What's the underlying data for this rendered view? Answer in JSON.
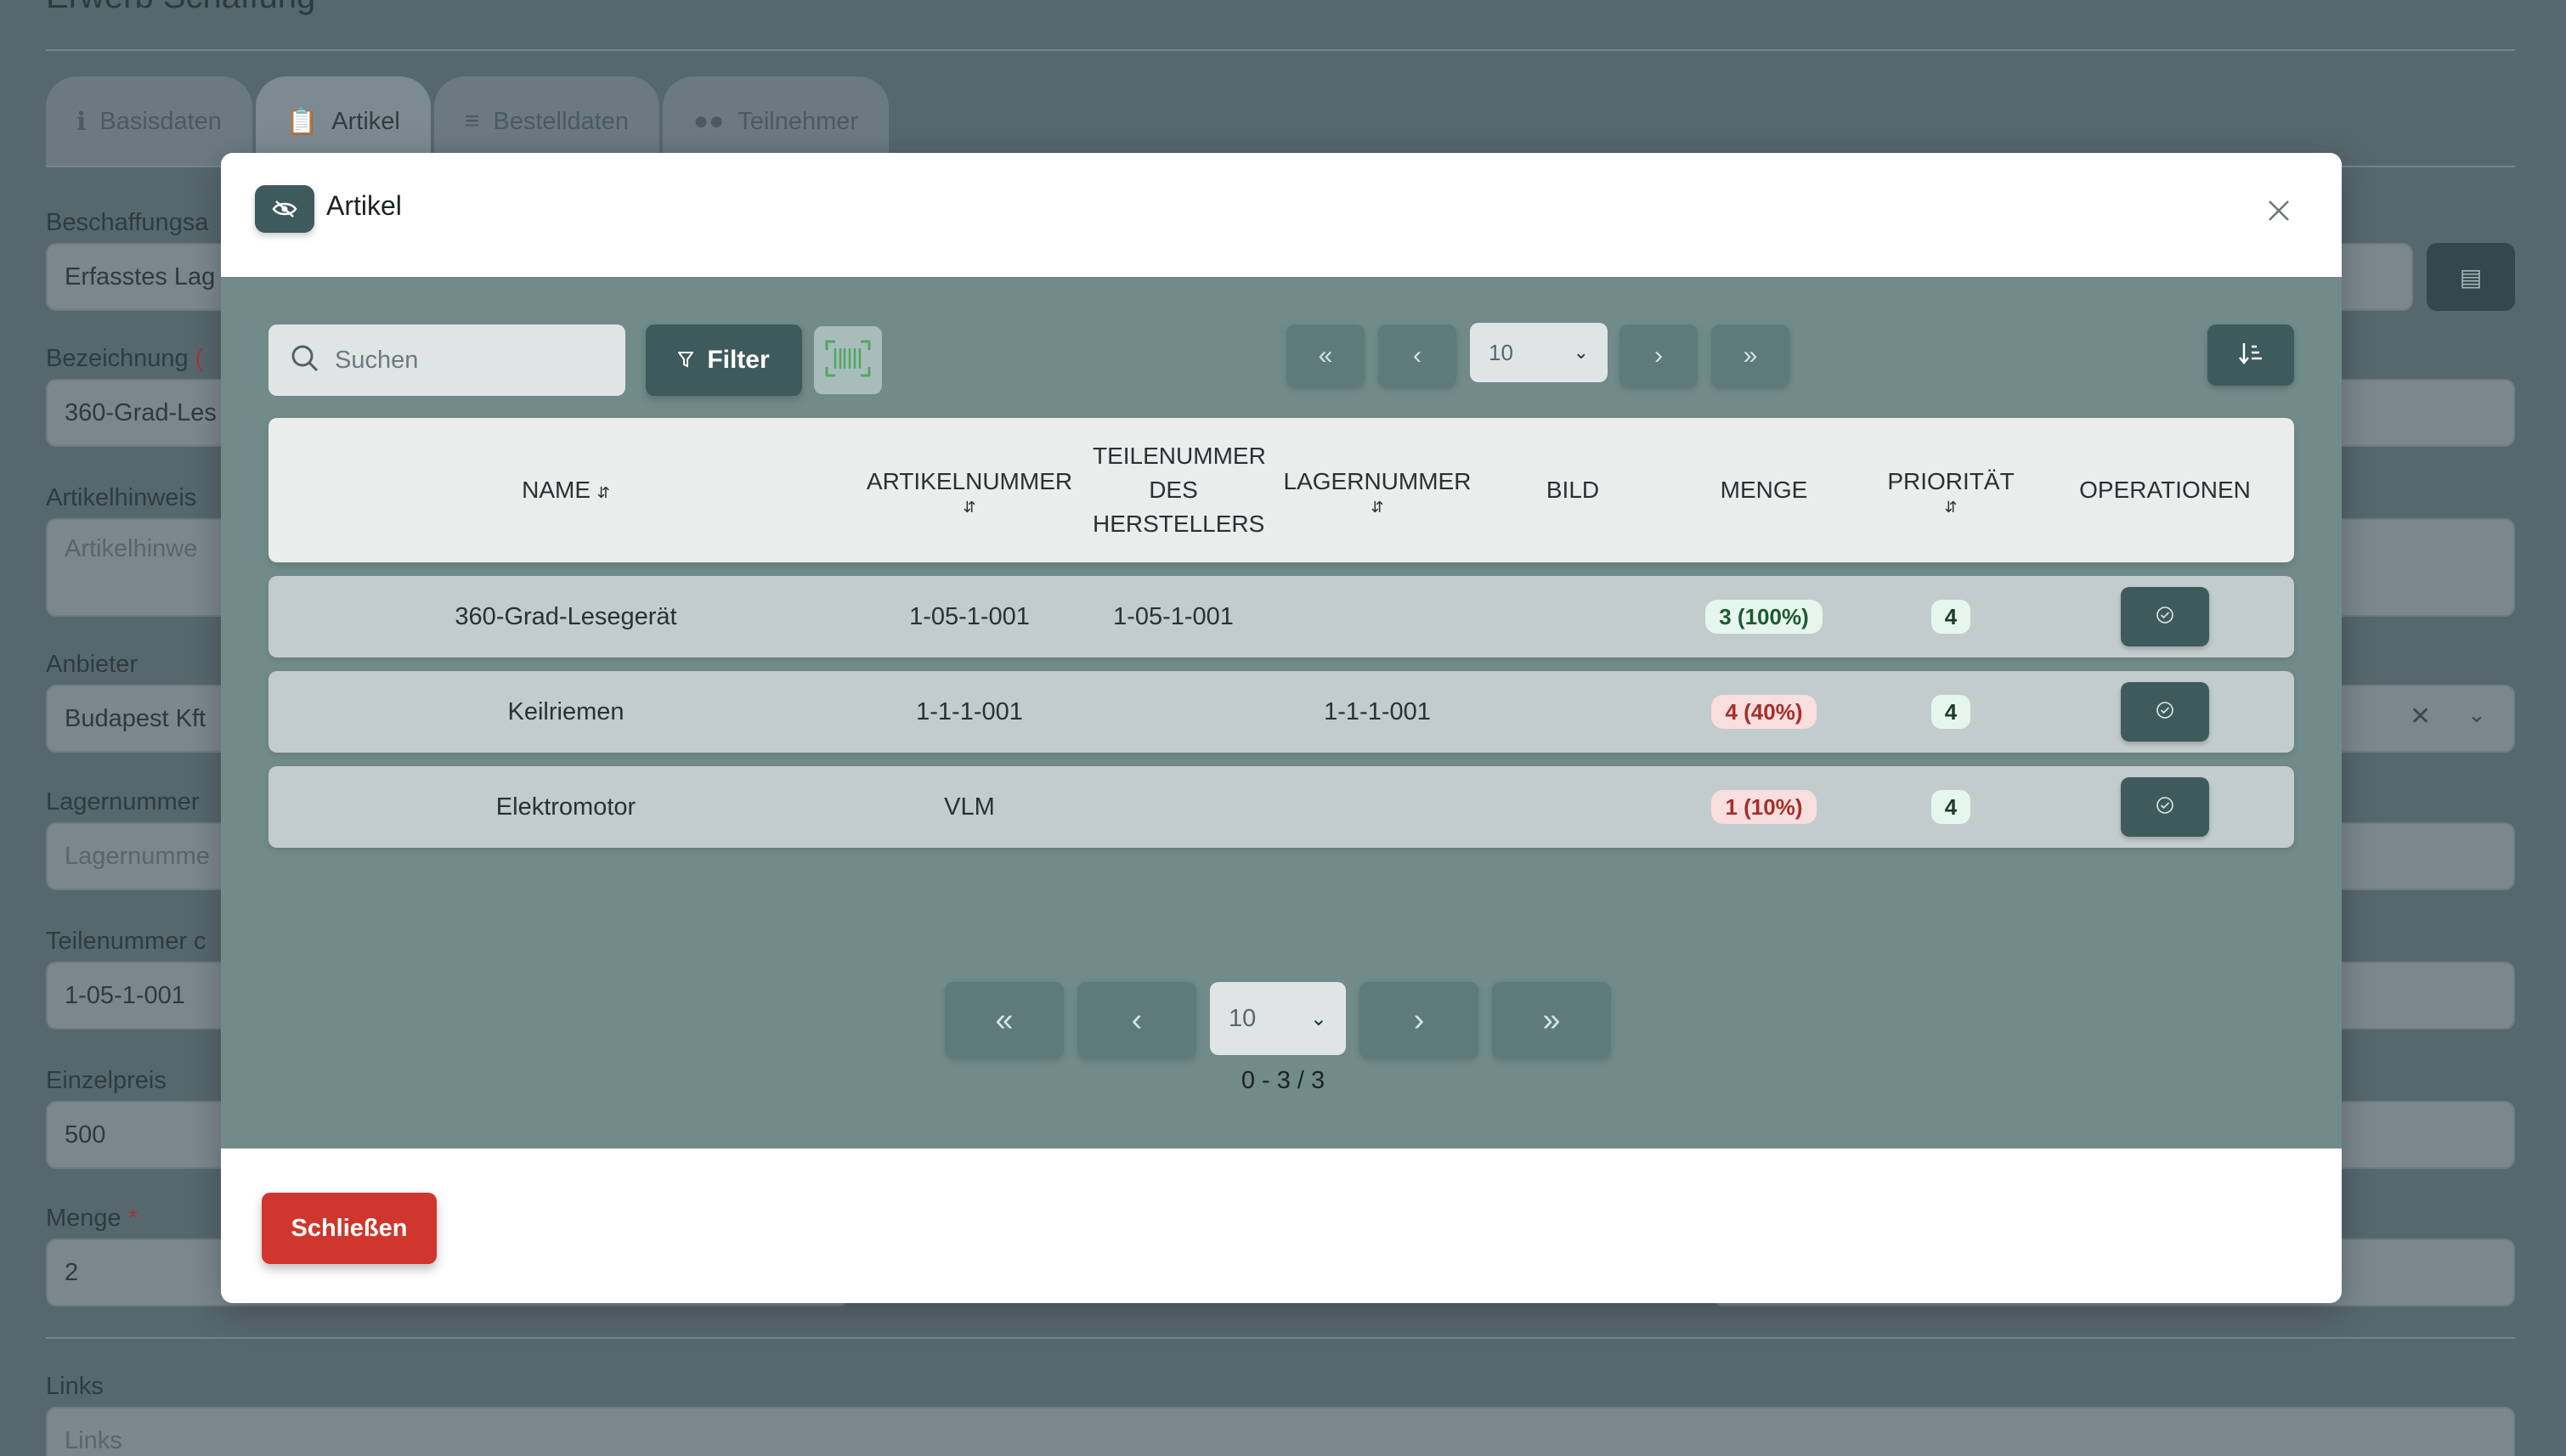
{
  "background": {
    "page_title": "Erwerb Schaffung",
    "tabs": [
      {
        "label": "Basisdaten",
        "icon": "info-icon"
      },
      {
        "label": "Artikel",
        "icon": "clipboard-icon"
      },
      {
        "label": "Bestelldaten",
        "icon": "list-icon"
      },
      {
        "label": "Teilnehmer",
        "icon": "users-icon"
      }
    ],
    "fields": {
      "beschaffung_label": "Beschaffungsa",
      "beschaffung_value": "Erfasstes Lag",
      "bezeichnung_label": "Bezeichnung",
      "bezeichnung_req": "(",
      "bezeichnung_value": "360-Grad-Les",
      "artikelhinweis_label": "Artikelhinweis",
      "artikelhinweis_placeholder": "Artikelhinwe",
      "anbieter_label": "Anbieter",
      "anbieter_value": "Budapest Kft",
      "lagernummer_label": "Lagernummer",
      "lagernummer_placeholder": "Lagernumme",
      "teilenummer_label": "Teilenummer c",
      "teilenummer_value": "1-05-1-001",
      "einzelpreis_label": "Einzelpreis",
      "einzelpreis_value": "500",
      "menge_label": "Menge",
      "menge_req": "*",
      "menge_value": "2",
      "links_label": "Links",
      "links_placeholder": "Links"
    }
  },
  "modal": {
    "title": "Artikel",
    "search_placeholder": "Suchen",
    "filter_label": "Filter",
    "page_size": "10",
    "columns": [
      "NAME",
      "ARTIKELNUMMER",
      "TEILENUMMER DES HERSTELLERS",
      "LAGERNUMMER",
      "BILD",
      "MENGE",
      "PRIORITÄT",
      "OPERATIONEN"
    ],
    "rows": [
      {
        "name": "360-Grad-Lesegerät",
        "artikelnummer": "1-05-1-001",
        "teilenummer": "1-05-1-001",
        "lagernummer": "",
        "menge": "3 (100%)",
        "menge_status": "ok",
        "prioritaet": "4"
      },
      {
        "name": "Keilriemen",
        "artikelnummer": "1-1-1-001",
        "teilenummer": "",
        "lagernummer": "1-1-1-001",
        "menge": "4 (40%)",
        "menge_status": "warn",
        "prioritaet": "4"
      },
      {
        "name": "Elektromotor",
        "artikelnummer": "VLM",
        "teilenummer": "",
        "lagernummer": "",
        "menge": "1 (10%)",
        "menge_status": "warn",
        "prioritaet": "4"
      }
    ],
    "pagination_count": "0 - 3 / 3",
    "close_label": "Schließen"
  },
  "colors": {
    "accent": "#3e5a5c",
    "danger": "#d0362d",
    "body_bg": "#718b8b"
  }
}
